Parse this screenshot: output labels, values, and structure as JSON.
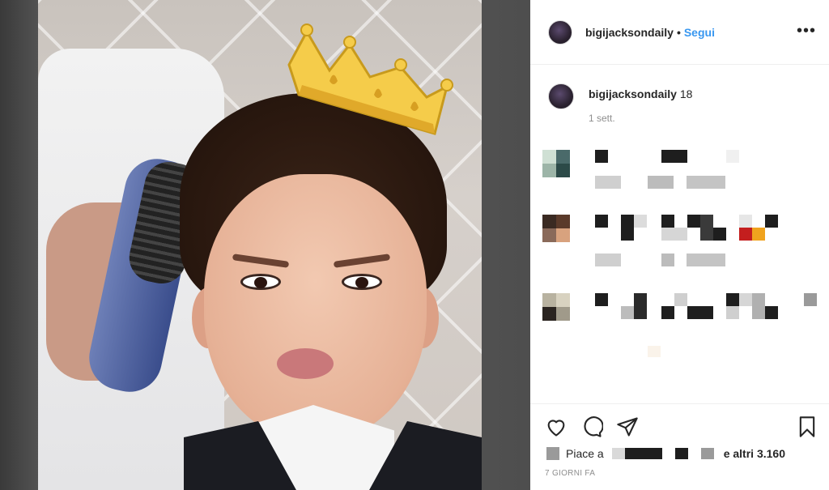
{
  "post": {
    "username": "bigijacksondaily",
    "separator": "•",
    "follow_label": "Segui",
    "more_icon": "more-options-icon",
    "more_glyph": "•••"
  },
  "caption": {
    "username": "bigijacksondaily",
    "text": "18",
    "time": "1 sett."
  },
  "actions": {
    "like_icon": "heart-icon",
    "comment_icon": "comment-icon",
    "share_icon": "share-icon",
    "save_icon": "bookmark-icon",
    "likes_prefix": "Piace a",
    "likes_suffix": "e altri 3.160",
    "posted_ago": "7 GIORNI FA"
  },
  "colors": {
    "link_blue": "#3897f0",
    "text_dark": "#262626",
    "text_muted": "#8e8e8e"
  }
}
